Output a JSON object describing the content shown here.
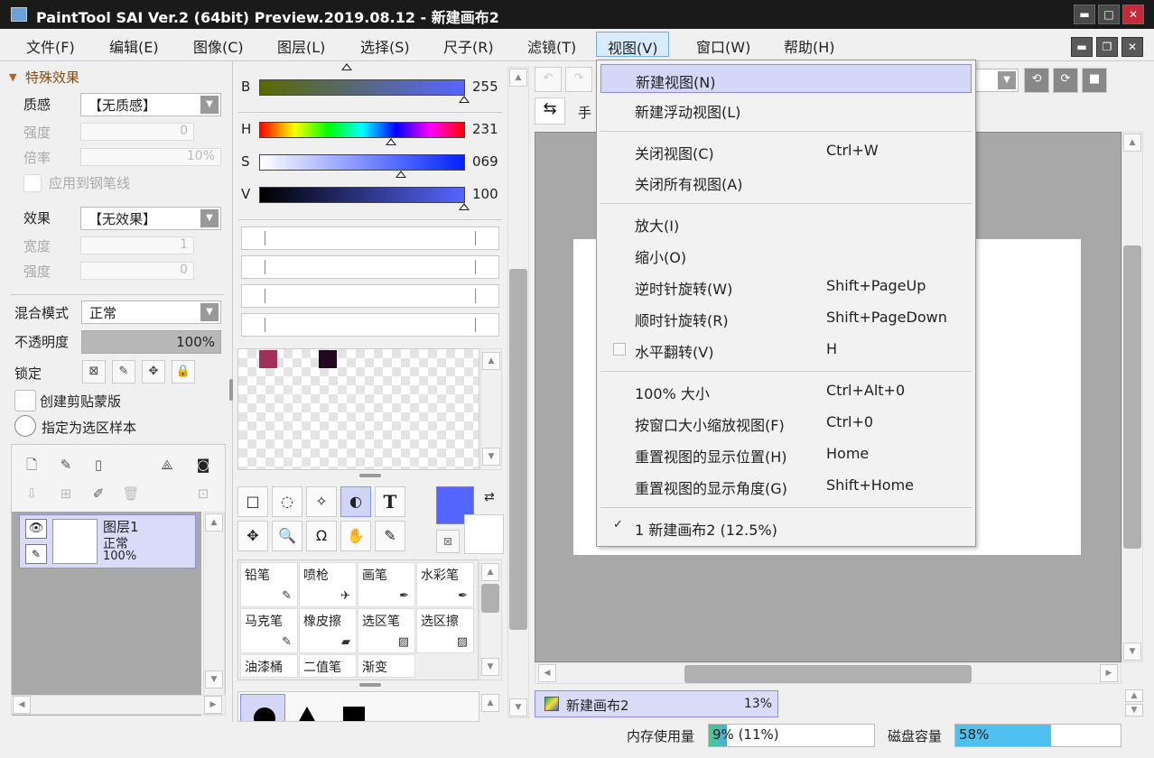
{
  "window": {
    "title": "PaintTool SAI Ver.2 (64bit) Preview.2019.08.12 - 新建画布2",
    "min": "▬",
    "max": "□",
    "close": "✕"
  },
  "menubar": {
    "items": [
      "文件(F)",
      "编辑(E)",
      "图像(C)",
      "图层(L)",
      "选择(S)",
      "尺子(R)",
      "滤镜(T)",
      "视图(V)",
      "窗口(W)",
      "帮助(H)"
    ],
    "active": "视图(V)"
  },
  "left": {
    "section_title": "特殊效果",
    "texture_label": "质感",
    "texture_value": "【无质感】",
    "texture_strength_label": "强度",
    "texture_strength_value": "0",
    "texture_scale_label": "倍率",
    "texture_scale_value": "10%",
    "apply_pen_label": "应用到钢笔线",
    "effect_label": "效果",
    "effect_value": "【无效果】",
    "effect_width_label": "宽度",
    "effect_width_value": "1",
    "effect_strength_label": "强度",
    "effect_strength_value": "0",
    "blend_label": "混合模式",
    "blend_value": "正常",
    "opacity_label": "不透明度",
    "opacity_value": "100%",
    "opacity_level": 1.0,
    "lock_label": "锁定",
    "clip_label": "创建剪贴蒙版",
    "selsrc_label": "指定为选区样本",
    "layer": {
      "name": "图层1",
      "mode": "正常",
      "opacity": "100%"
    }
  },
  "color": {
    "b_label": "B",
    "b_value": "255",
    "h_label": "H",
    "h_value": "231",
    "s_label": "S",
    "s_value": "069",
    "v_label": "V",
    "v_value": "100",
    "fg": "#5566ff",
    "bg": "#ffffff",
    "swatches": [
      "#a0305a",
      "#200820"
    ]
  },
  "tools": [
    "□",
    "◌",
    "✧",
    "◐",
    "T",
    "✥",
    "🔍",
    "Ω",
    "✋",
    "✎"
  ],
  "brushes": [
    {
      "name": "铅笔",
      "icon": "✎"
    },
    {
      "name": "喷枪",
      "icon": "✈"
    },
    {
      "name": "画笔",
      "icon": "✒"
    },
    {
      "name": "水彩笔",
      "icon": "✒"
    },
    {
      "name": "马克笔",
      "icon": "✎"
    },
    {
      "name": "橡皮擦",
      "icon": "▰"
    },
    {
      "name": "选区笔",
      "icon": "▨"
    },
    {
      "name": "选区擦",
      "icon": "▨"
    },
    {
      "name": "油漆桶",
      "icon": ""
    },
    {
      "name": "二值笔",
      "icon": ""
    },
    {
      "name": "渐变",
      "icon": ""
    }
  ],
  "canvas": {
    "nav_label": "手",
    "doc_tab": "新建画布2",
    "doc_zoom": "13%"
  },
  "status": {
    "mem_label": "内存使用量",
    "mem_value": "9% (11%)",
    "mem_level": 0.09,
    "disk_label": "磁盘容量",
    "disk_value": "58%",
    "disk_level": 0.58
  },
  "viewmenu": {
    "items": [
      {
        "label": "新建视图(N)",
        "shortcut": ""
      },
      {
        "label": "新建浮动视图(L)",
        "shortcut": ""
      },
      {
        "label": "关闭视图(C)",
        "shortcut": "Ctrl+W"
      },
      {
        "label": "关闭所有视图(A)",
        "shortcut": ""
      },
      {
        "label": "放大(I)",
        "shortcut": ""
      },
      {
        "label": "缩小(O)",
        "shortcut": ""
      },
      {
        "label": "逆时针旋转(W)",
        "shortcut": "Shift+PageUp"
      },
      {
        "label": "顺时针旋转(R)",
        "shortcut": "Shift+PageDown"
      },
      {
        "label": "水平翻转(V)",
        "shortcut": "H"
      },
      {
        "label": "100% 大小",
        "shortcut": "Ctrl+Alt+0"
      },
      {
        "label": "按窗口大小缩放视图(F)",
        "shortcut": "Ctrl+0"
      },
      {
        "label": "重置视图的显示位置(H)",
        "shortcut": "Home"
      },
      {
        "label": "重置视图的显示角度(G)",
        "shortcut": "Shift+Home"
      },
      {
        "label": "1 新建画布2 (12.5%)",
        "shortcut": ""
      }
    ]
  }
}
